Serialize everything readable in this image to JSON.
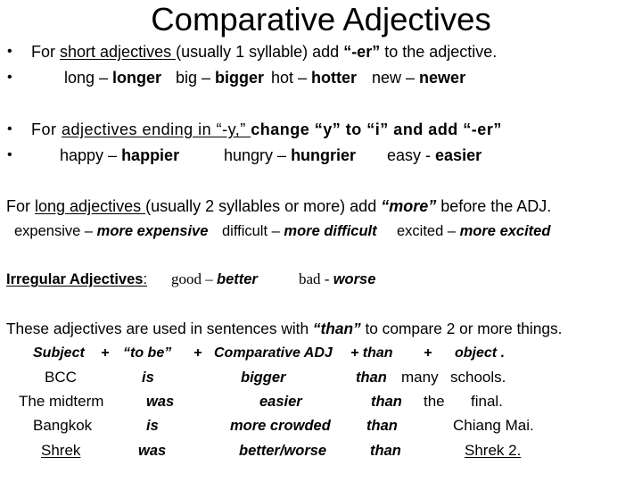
{
  "title": "Comparative Adjectives",
  "bullet": "•",
  "short_rule": {
    "prefix": "For ",
    "underlined": "short adjectives ",
    "middle": "(usually 1 syllable) add ",
    "emphasis": "“-er”",
    "suffix": " to the adjective."
  },
  "short_examples": [
    {
      "base": "long",
      "sep": " – ",
      "comparative": "longer"
    },
    {
      "base": "big",
      "sep": " – ",
      "comparative": "bigger"
    },
    {
      "base": "hot",
      "sep": " – ",
      "comparative": "hotter"
    },
    {
      "base": "new",
      "sep": " – ",
      "comparative": "newer"
    }
  ],
  "y_rule": {
    "prefix": "For ",
    "underlined": "adjectives ending in “-y,” ",
    "emphasis": "change “y” to “i” and add “-er”"
  },
  "y_examples": [
    {
      "base": "happy",
      "sep": " – ",
      "comparative": "happier"
    },
    {
      "base": "hungry",
      "sep": " – ",
      "comparative": "hungrier"
    },
    {
      "base": "easy",
      "sep": " - ",
      "comparative": "easier"
    }
  ],
  "long_rule": {
    "prefix": "For ",
    "underlined": "long adjectives ",
    "middle": "(usually 2 syllables or more) add ",
    "emphasis": "“more”",
    "suffix": " before the ADJ."
  },
  "long_examples": [
    {
      "base": "expensive",
      "sep": " – ",
      "comparative": "more expensive"
    },
    {
      "base": "difficult",
      "sep": " – ",
      "comparative": "more difficult"
    },
    {
      "base": "excited",
      "sep": " – ",
      "comparative": "more excited"
    }
  ],
  "irregular": {
    "label": "Irregular Adjectives",
    "colon": ":",
    "examples": [
      {
        "base": "good",
        "sep": " – ",
        "comparative": "better"
      },
      {
        "base": "bad",
        "sep": " - ",
        "comparative": "worse"
      }
    ]
  },
  "usage": {
    "prefix": "These adjectives are used in sentences with ",
    "emphasis": "“than”",
    "suffix": " to compare 2 or more things.",
    "formula": {
      "subject": "Subject",
      "plus_1": "+",
      "to_be": "“to be”",
      "plus_2": "+",
      "comparative": "Comparative ADJ",
      "than": "+ than",
      "plus_3": "+",
      "object": "object ."
    },
    "examples": [
      {
        "subject": "BCC",
        "verb": "is",
        "adjective": "bigger",
        "than": "than",
        "object": [
          "many",
          "schools."
        ]
      },
      {
        "subject": "The midterm",
        "verb": "was",
        "adjective": "easier",
        "than": "than",
        "object": [
          "the",
          "final."
        ]
      },
      {
        "subject": "Bangkok",
        "verb": "is",
        "adjective": "more crowded",
        "than": "than",
        "object": [
          "Chiang Mai."
        ]
      },
      {
        "subject": "Shrek",
        "verb": "was",
        "adjective": "better/worse",
        "than": "than",
        "object": [
          "Shrek 2."
        ]
      }
    ]
  }
}
